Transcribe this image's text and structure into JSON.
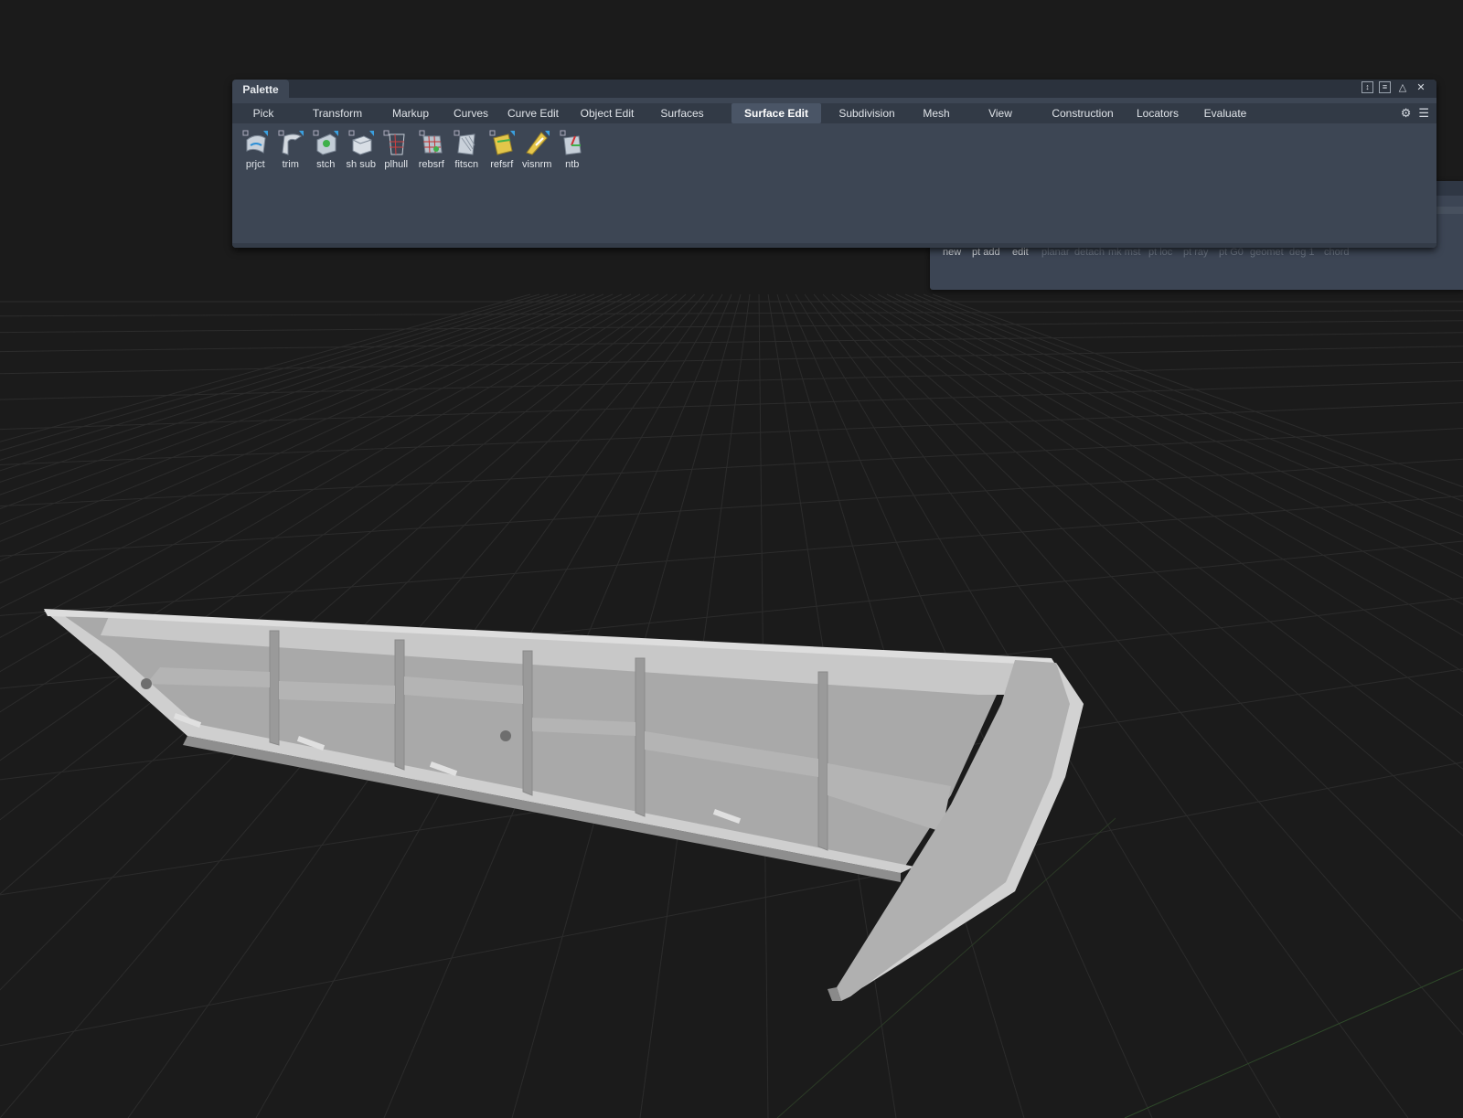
{
  "palette": {
    "title": "Palette",
    "window_controls": {
      "pin": "↕",
      "list": "≡",
      "collapse": "△",
      "close": "✕"
    },
    "tabs": [
      {
        "label": "Pick",
        "active": false
      },
      {
        "label": "Transform",
        "active": false
      },
      {
        "label": "Markup",
        "active": false
      },
      {
        "label": "Curves",
        "active": false
      },
      {
        "label": "Curve Edit",
        "active": false
      },
      {
        "label": "Object Edit",
        "active": false
      },
      {
        "label": "Surfaces",
        "active": false
      },
      {
        "label": "Surface Edit",
        "active": true
      },
      {
        "label": "Subdivision",
        "active": false
      },
      {
        "label": "Mesh",
        "active": false
      },
      {
        "label": "View",
        "active": false
      },
      {
        "label": "Construction",
        "active": false
      },
      {
        "label": "Locators",
        "active": false
      },
      {
        "label": "Evaluate",
        "active": false
      }
    ],
    "tabs_right": {
      "settings_icon": "⚙",
      "menu_icon": "☰"
    },
    "tools": [
      {
        "label": "prjct",
        "icon": "project-icon"
      },
      {
        "label": "trim",
        "icon": "trim-icon"
      },
      {
        "label": "stch",
        "icon": "stitch-icon"
      },
      {
        "label": "sh sub",
        "icon": "shell-subtract-icon"
      },
      {
        "label": "plhull",
        "icon": "polyhull-icon"
      },
      {
        "label": "rebsrf",
        "icon": "rebuild-surface-icon"
      },
      {
        "label": "fitscn",
        "icon": "fit-scan-icon"
      },
      {
        "label": "refsrf",
        "icon": "reference-surface-icon"
      },
      {
        "label": "visnrm",
        "icon": "visualize-normals-icon"
      },
      {
        "label": "ntb",
        "icon": "ntb-icon"
      }
    ]
  },
  "shelf2": {
    "items": [
      {
        "label": "new",
        "dim": false
      },
      {
        "label": "pt add",
        "dim": false
      },
      {
        "label": "edit",
        "dim": false
      },
      {
        "label": "planar",
        "dim": true
      },
      {
        "label": "detach",
        "dim": true
      },
      {
        "label": "mk mst",
        "dim": true
      },
      {
        "label": "pt loc",
        "dim": true
      },
      {
        "label": "pt ray",
        "dim": true
      },
      {
        "label": "pt G0",
        "dim": true
      },
      {
        "label": "geomet",
        "dim": true
      },
      {
        "label": "deg 1",
        "dim": true
      },
      {
        "label": "chord",
        "dim": true
      }
    ]
  },
  "colors": {
    "viewport_bg": "#1b1b1b",
    "grid": "#2c2c2c",
    "palette_bg": "#3d4654",
    "active_tab": "#4a5566",
    "model": "#bdbdbd"
  }
}
